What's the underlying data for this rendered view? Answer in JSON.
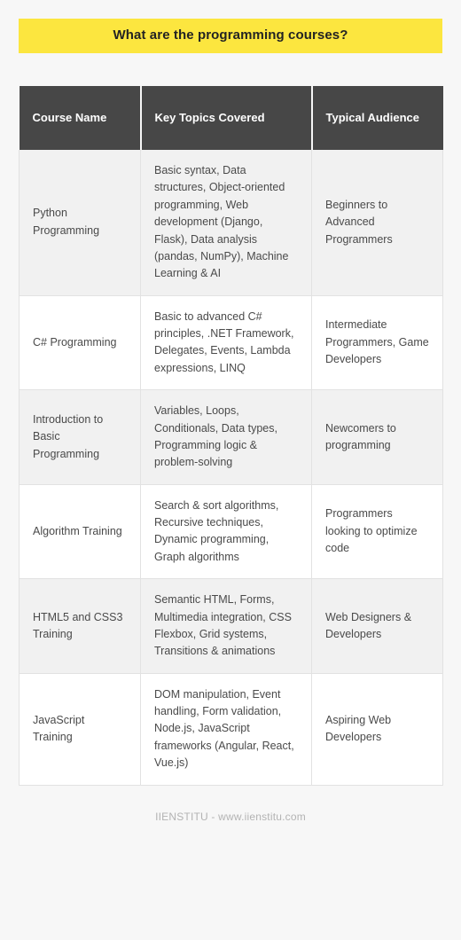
{
  "banner": {
    "title": "What are the programming courses?",
    "background_color": "#fce63f",
    "text_color": "#232323"
  },
  "table": {
    "header_background": "#474747",
    "header_text_color": "#ffffff",
    "columns": [
      {
        "label": "Course Name"
      },
      {
        "label": "Key Topics Covered"
      },
      {
        "label": "Typical Audience"
      }
    ],
    "rows": [
      {
        "course": "Python Programming",
        "topics": "Basic syntax, Data structures, Object-oriented programming, Web development (Django, Flask), Data analysis (pandas, NumPy), Machine Learning & AI",
        "audience": "Beginners to Advanced Programmers"
      },
      {
        "course": "C# Programming",
        "topics": "Basic to advanced C# principles, .NET Framework, Delegates, Events, Lambda expressions, LINQ",
        "audience": "Intermediate Programmers, Game Developers"
      },
      {
        "course": "Introduction to Basic Programming",
        "topics": "Variables, Loops, Conditionals, Data types, Programming logic & problem-solving",
        "audience": "Newcomers to programming"
      },
      {
        "course": "Algorithm Training",
        "topics": "Search & sort algorithms, Recursive techniques, Dynamic programming, Graph algorithms",
        "audience": "Programmers looking to optimize code"
      },
      {
        "course": "HTML5 and CSS3 Training",
        "topics": "Semantic HTML, Forms, Multimedia integration, CSS Flexbox, Grid systems, Transitions & animations",
        "audience": "Web Designers & Developers"
      },
      {
        "course": "JavaScript Training",
        "topics": "DOM manipulation, Event handling, Form validation, Node.js, JavaScript frameworks (Angular, React, Vue.js)",
        "audience": "Aspiring Web Developers"
      }
    ]
  },
  "footer": {
    "text": "IIENSTITU - www.iienstitu.com",
    "text_color": "#b3b3b3"
  }
}
